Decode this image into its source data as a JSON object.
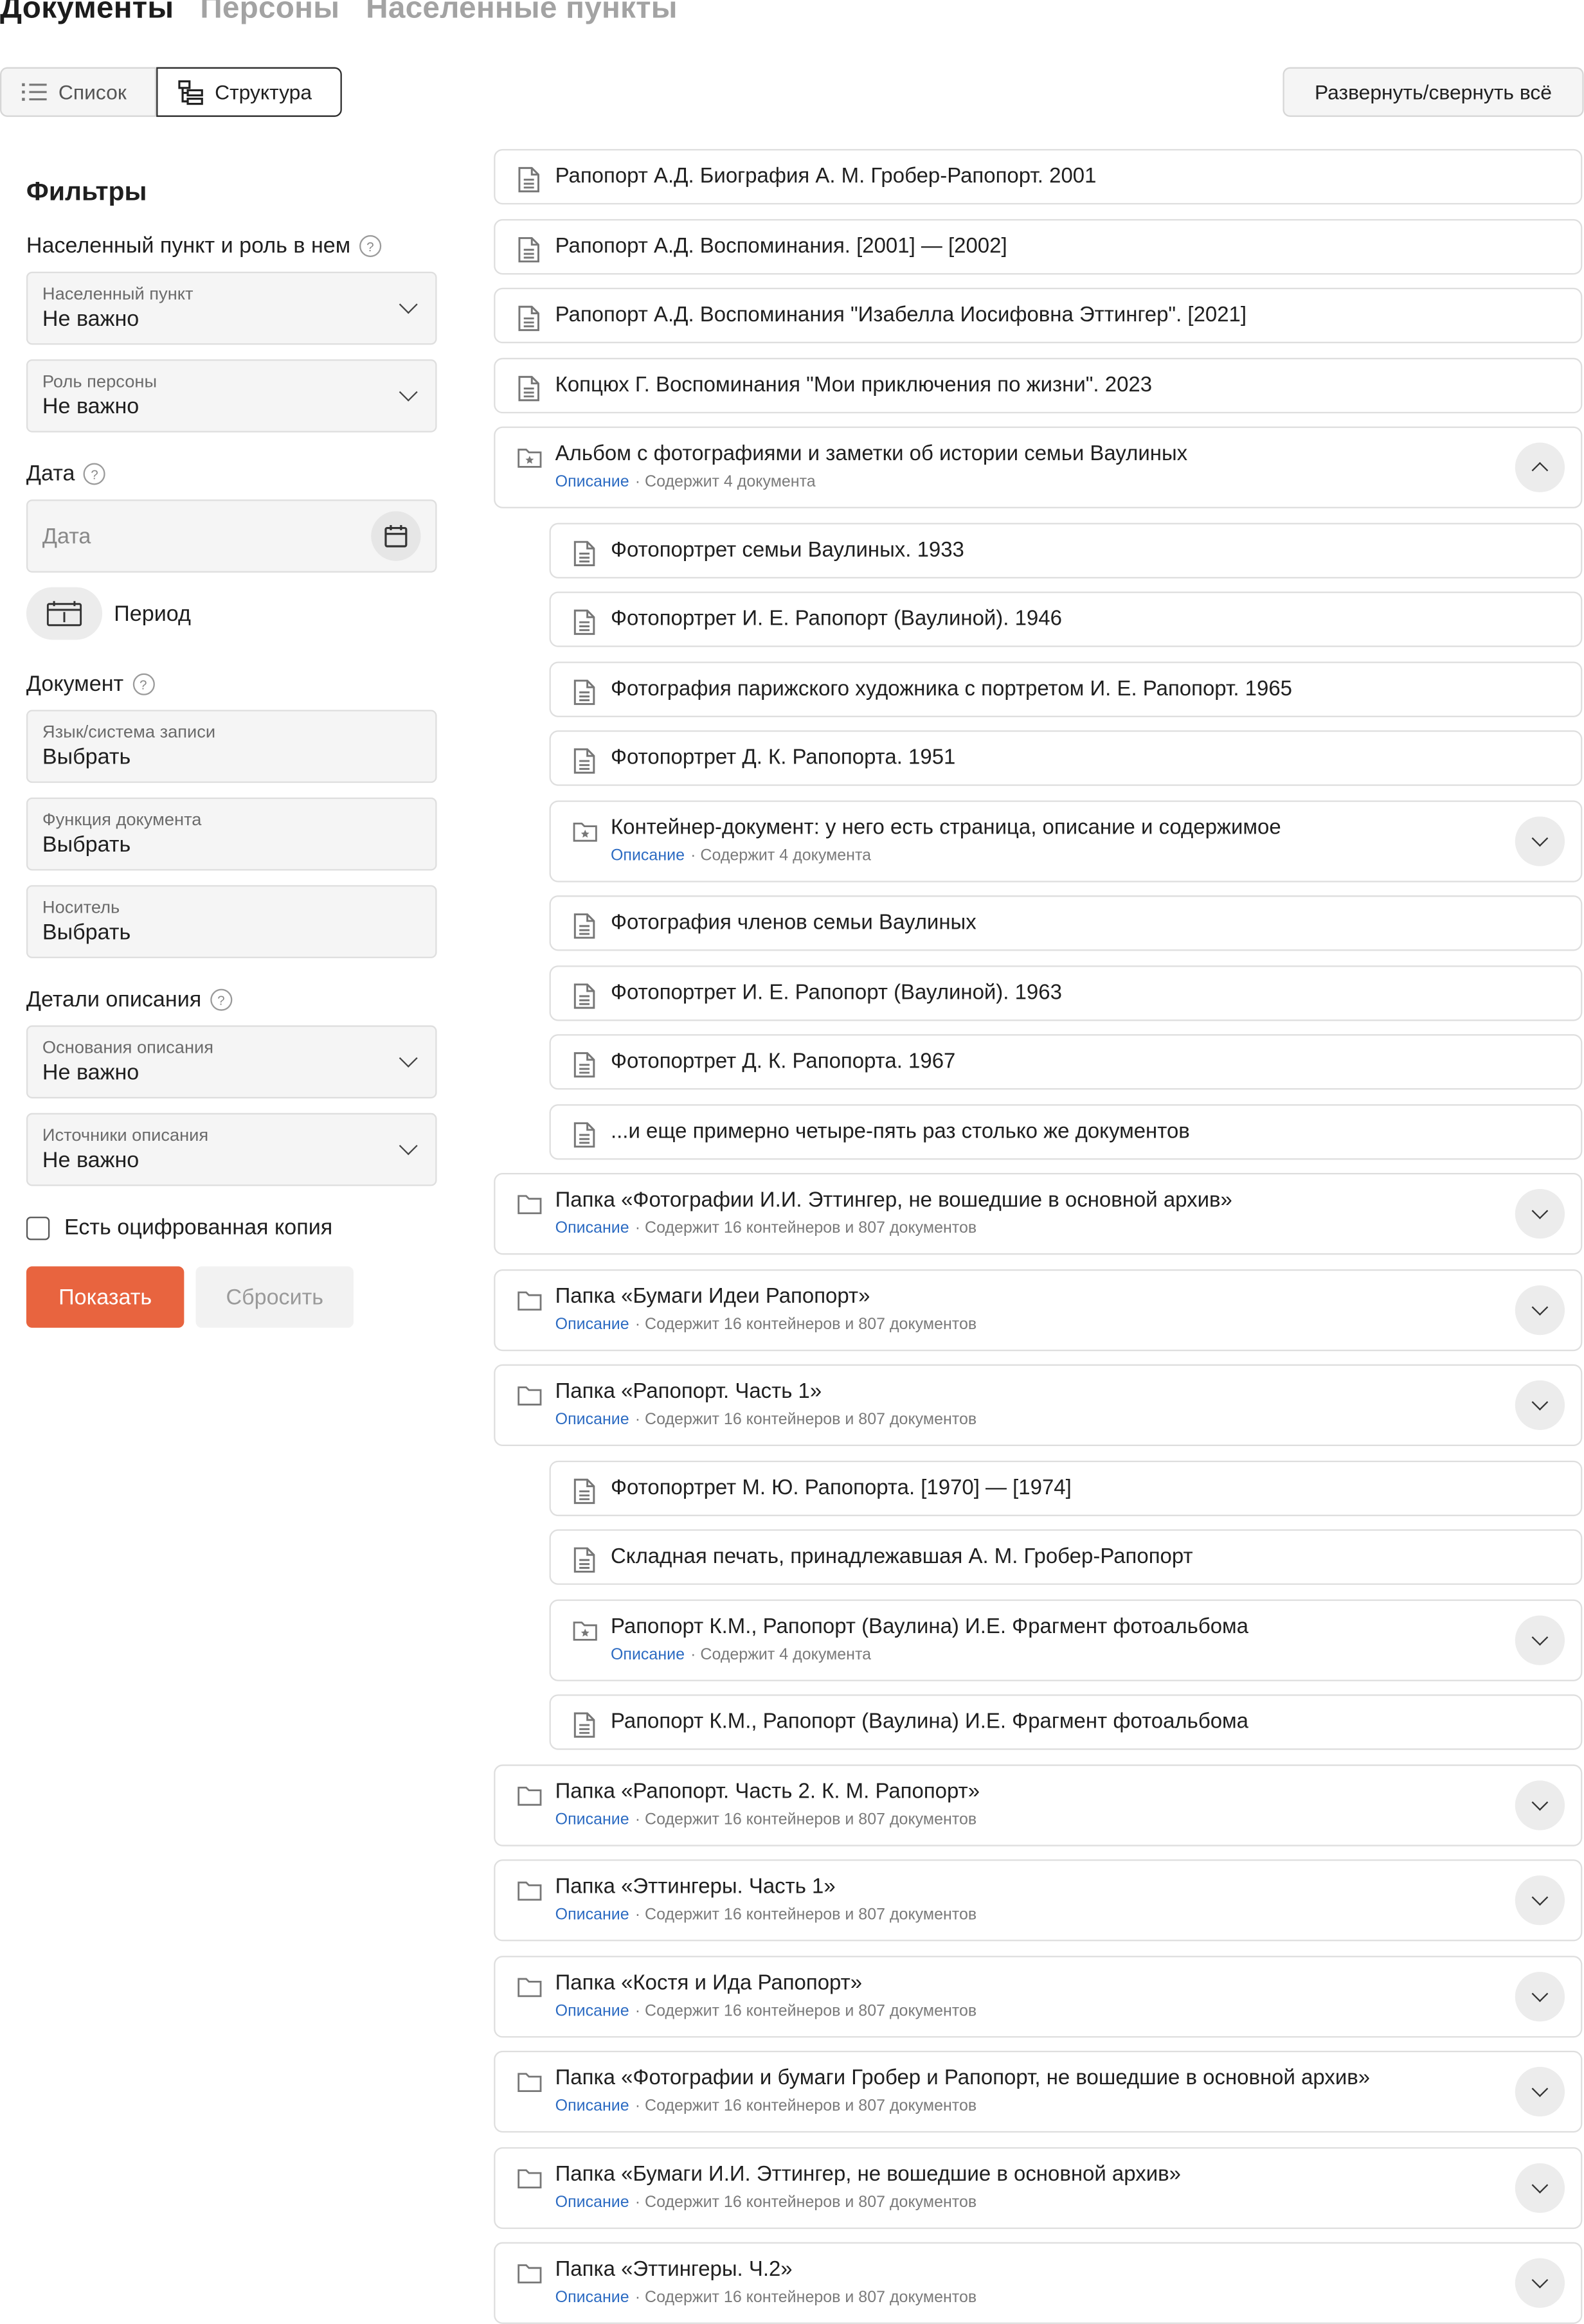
{
  "tabs": [
    "Документы",
    "Персоны",
    "Населенные пункты"
  ],
  "view_toggle": {
    "list_label": "Список",
    "structure_label": "Структура",
    "selected": "Структура"
  },
  "expand_all_label": "Развернуть/свернуть всё",
  "filters": {
    "title": "Фильтры",
    "place_section": "Населенный пункт и роль в нем",
    "place_field": {
      "label": "Населенный пункт",
      "value": "Не важно"
    },
    "role_field": {
      "label": "Роль персоны",
      "value": "Не важно"
    },
    "date_section": "Дата",
    "date_placeholder": "Дата",
    "period_label": "Период",
    "document_section": "Документ",
    "language_field": {
      "label": "Язык/система записи",
      "value": "Выбрать"
    },
    "function_field": {
      "label": "Функция документа",
      "value": "Выбрать"
    },
    "carrier_field": {
      "label": "Носитель",
      "value": "Выбрать"
    },
    "details_section": "Детали описания",
    "basis_field": {
      "label": "Основания описания",
      "value": "Не важно"
    },
    "sources_field": {
      "label": "Источники описания",
      "value": "Не важно"
    },
    "digitized_label": "Есть оцифрованная копия",
    "show_label": "Показать",
    "reset_label": "Сбросить"
  },
  "tree": [
    {
      "level": 0,
      "kind": "document",
      "title": "Рапопорт А.Д. Биография А. М. Гробер-Рапопорт. 2001"
    },
    {
      "level": 0,
      "kind": "document",
      "title": "Рапопорт А.Д. Воспоминания. [2001] — [2002]"
    },
    {
      "level": 0,
      "kind": "document",
      "title": "Рапопорт А.Д. Воспоминания \"Изабелла Иосифовна Эттингер\". [2021]"
    },
    {
      "level": 0,
      "kind": "document",
      "title": "Копцюх Г. Воспоминания \"Мои приключения по жизни\". 2023"
    },
    {
      "level": 0,
      "kind": "container",
      "title": "Альбом с фотографиями и заметки об истории семьи Ваулиных",
      "desc": "Описание",
      "meta": "· Содержит 4 документа",
      "expanded": true
    },
    {
      "level": 1,
      "kind": "document",
      "title": "Фотопортрет семьи Ваулиных. 1933"
    },
    {
      "level": 1,
      "kind": "document",
      "title": "Фотопортрет И. Е. Рапопорт (Ваулиной). 1946"
    },
    {
      "level": 1,
      "kind": "document",
      "title": "Фотография парижского художника с портретом И. Е. Рапопорт. 1965"
    },
    {
      "level": 1,
      "kind": "document",
      "title": "Фотопортрет Д. К. Рапопорта. 1951"
    },
    {
      "level": 1,
      "kind": "container",
      "title": "Контейнер-документ: у него есть страница, описание и содержимое",
      "desc": "Описание",
      "meta": "· Содержит 4 документа",
      "expanded": false
    },
    {
      "level": 1,
      "kind": "document",
      "title": "Фотография членов семьи Ваулиных"
    },
    {
      "level": 1,
      "kind": "document",
      "title": "Фотопортрет И. Е. Рапопорт (Ваулиной). 1963"
    },
    {
      "level": 1,
      "kind": "document",
      "title": "Фотопортрет Д. К. Рапопорта. 1967"
    },
    {
      "level": 1,
      "kind": "document",
      "title": "...и еще примерно четыре-пять раз столько же документов"
    },
    {
      "level": 0,
      "kind": "folder",
      "title": "Папка «Фотографии И.И. Эттингер, не вошедшие в основной архив»",
      "desc": "Описание",
      "meta": "· Содержит 16 контейнеров и 807 документов",
      "expanded": false
    },
    {
      "level": 0,
      "kind": "folder",
      "title": "Папка «Бумаги Идеи Рапопорт»",
      "desc": "Описание",
      "meta": "· Содержит 16 контейнеров и 807 документов",
      "expanded": false
    },
    {
      "level": 0,
      "kind": "folder",
      "title": "Папка «Рапопорт. Часть 1»",
      "desc": "Описание",
      "meta": "· Содержит 16 контейнеров и 807 документов",
      "expanded": false
    },
    {
      "level": 1,
      "kind": "document",
      "title": "Фотопортрет М. Ю. Рапопорта. [1970] — [1974]"
    },
    {
      "level": 1,
      "kind": "document",
      "title": "Складная печать, принадлежавшая А. М. Гробер-Рапопорт"
    },
    {
      "level": 1,
      "kind": "container",
      "title": "Рапопорт К.М., Рапопорт (Ваулина) И.Е. Фрагмент фотоальбома",
      "desc": "Описание",
      "meta": "· Содержит 4 документа",
      "expanded": false
    },
    {
      "level": 1,
      "kind": "document",
      "title": "Рапопорт К.М., Рапопорт (Ваулина) И.Е. Фрагмент фотоальбома"
    },
    {
      "level": 0,
      "kind": "folder",
      "title": "Папка «Рапопорт. Часть 2. К. М. Рапопорт»",
      "desc": "Описание",
      "meta": "· Содержит 16 контейнеров и 807 документов",
      "expanded": false
    },
    {
      "level": 0,
      "kind": "folder",
      "title": "Папка «Эттингеры. Часть 1»",
      "desc": "Описание",
      "meta": "· Содержит 16 контейнеров и 807 документов",
      "expanded": false
    },
    {
      "level": 0,
      "kind": "folder",
      "title": "Папка «Костя и Ида Рапопорт»",
      "desc": "Описание",
      "meta": "· Содержит 16 контейнеров и 807 документов",
      "expanded": false
    },
    {
      "level": 0,
      "kind": "folder",
      "title": "Папка «Фотографии и бумаги Гробер и Рапопорт, не вошедшие в основной архив»",
      "desc": "Описание",
      "meta": "· Содержит 16 контейнеров и 807 документов",
      "expanded": false
    },
    {
      "level": 0,
      "kind": "folder",
      "title": "Папка «Бумаги И.И. Эттингер, не вошедшие в основной архив»",
      "desc": "Описание",
      "meta": "· Содержит 16 контейнеров и 807 документов",
      "expanded": false
    },
    {
      "level": 0,
      "kind": "folder",
      "title": "Папка «Эттингеры. Ч.2»",
      "desc": "Описание",
      "meta": "· Содержит 16 контейнеров и 807 документов",
      "expanded": false
    }
  ],
  "colors": {
    "accent": "#e8643f",
    "link": "#2c6bc2",
    "text": "#1f1f1f",
    "muted": "#a3a3a3"
  }
}
